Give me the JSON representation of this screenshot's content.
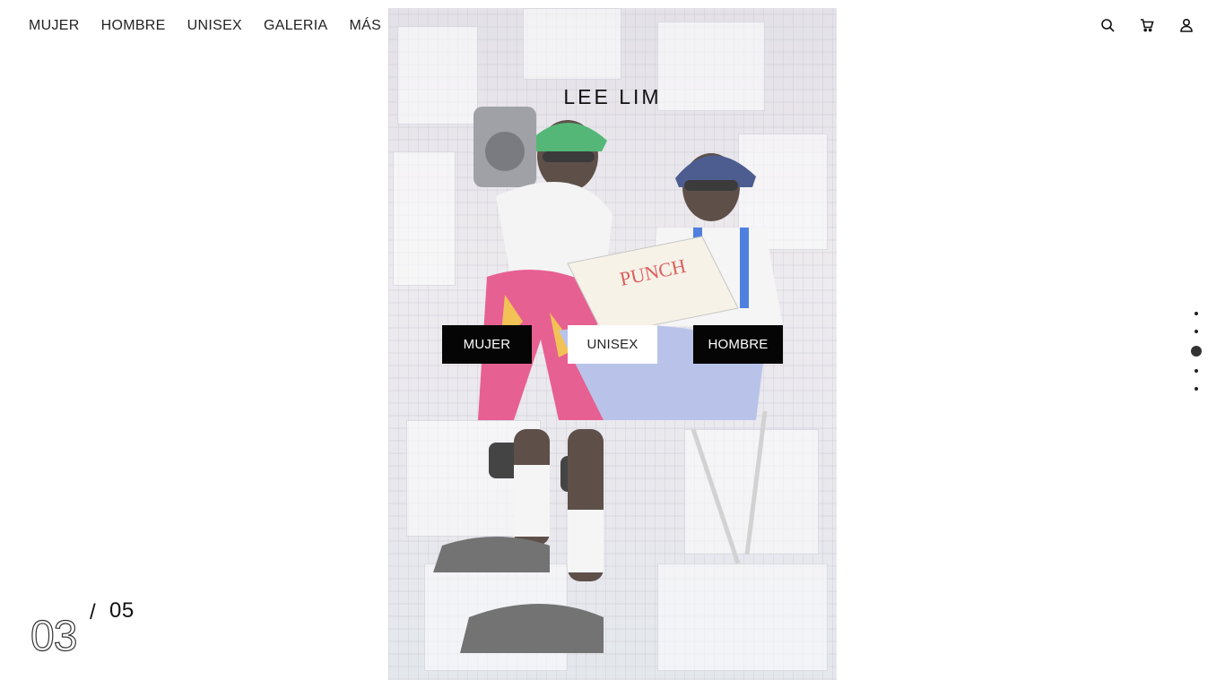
{
  "nav": {
    "items": [
      {
        "label": "MUJER"
      },
      {
        "label": "HOMBRE"
      },
      {
        "label": "UNISEX"
      },
      {
        "label": "GALERIA"
      },
      {
        "label": "MÁS"
      }
    ]
  },
  "header_icons": [
    "search-icon",
    "cart-icon",
    "user-icon"
  ],
  "hero": {
    "brand": "LEE LIM",
    "buttons": {
      "left": "MUJER",
      "center": "UNISEX",
      "right": "HOMBRE"
    }
  },
  "pager": {
    "current_index": 3,
    "count": 5
  },
  "counter": {
    "current": "03",
    "separator": "/",
    "total": "05"
  },
  "colors": {
    "button_dark": "#050505",
    "button_light": "#ffffff",
    "text": "#111111"
  }
}
